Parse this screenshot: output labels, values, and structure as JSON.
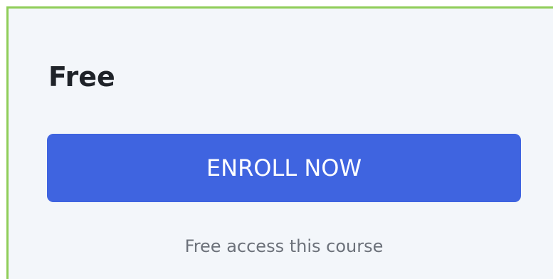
{
  "card": {
    "price_label": "Free",
    "enroll_button_label": "ENROLL NOW",
    "access_note": "Free access this course"
  },
  "colors": {
    "card_background": "#f3f6fa",
    "card_border": "#8fcd58",
    "button_background": "#3f64e0",
    "button_text": "#ffffff",
    "price_text": "#1f2329",
    "note_text": "#6c717a"
  }
}
